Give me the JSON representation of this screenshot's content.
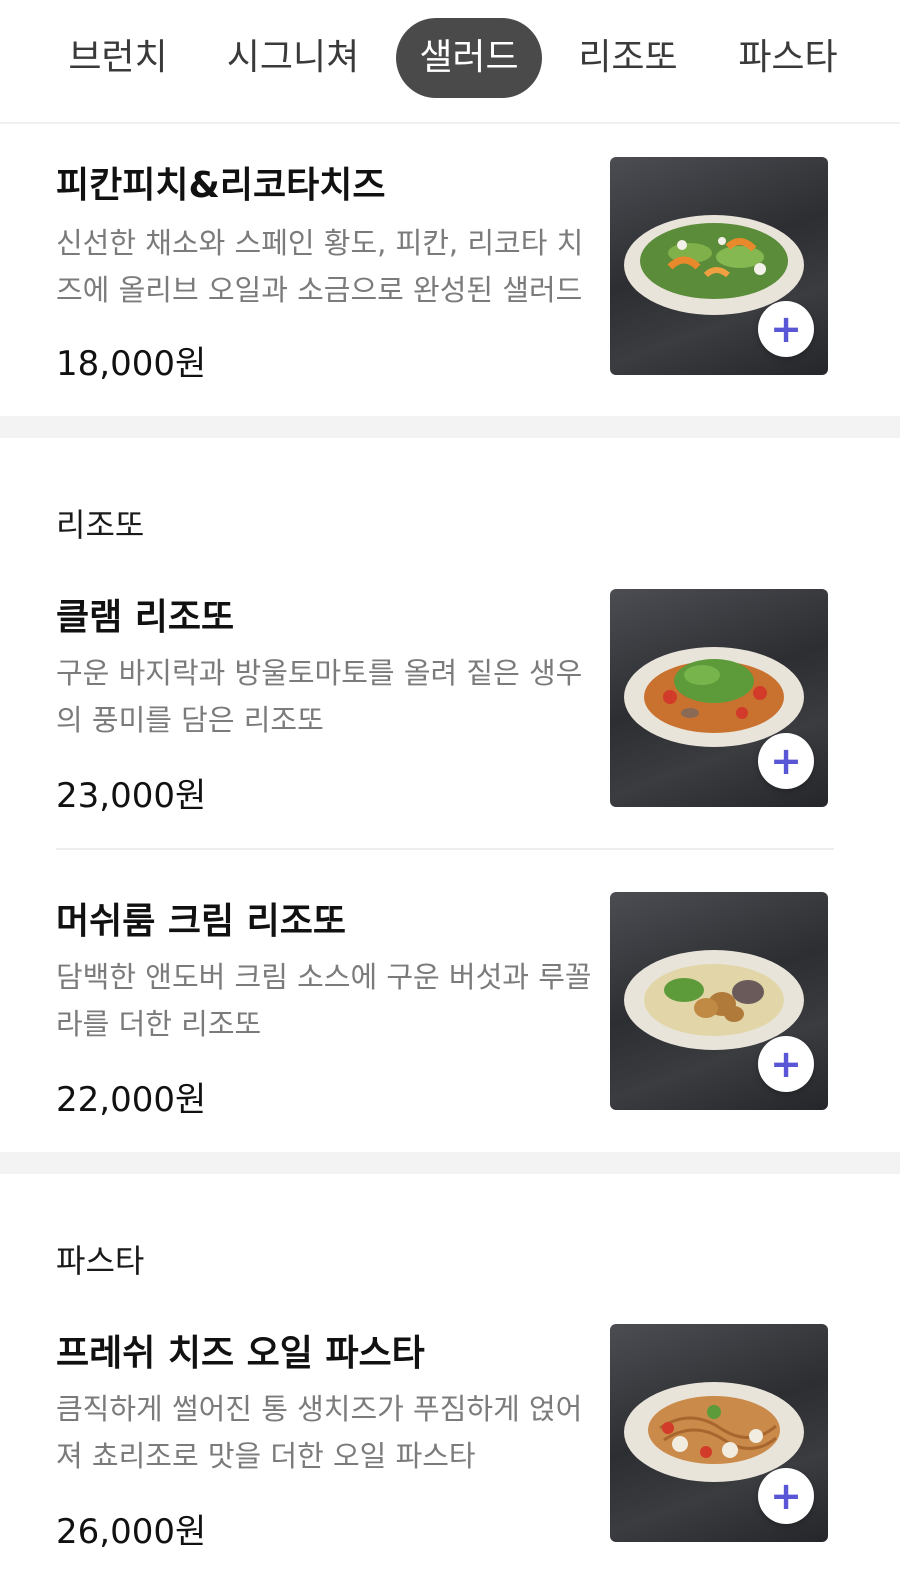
{
  "tabs": [
    {
      "label": "브런치",
      "active": false
    },
    {
      "label": "시그니쳐",
      "active": false
    },
    {
      "label": "샐러드",
      "active": true
    },
    {
      "label": "리조또",
      "active": false
    },
    {
      "label": "파스타",
      "active": false
    }
  ],
  "salad": {
    "items": [
      {
        "name": "피칸피치&리코타치즈",
        "description": "신선한 채소와 스페인 황도, 피칸, 리코타 치즈에 올리브 오일과 소금으로 완성된 샐러드",
        "price": "18,000원"
      }
    ]
  },
  "risotto": {
    "title": "리조또",
    "items": [
      {
        "name": "클램 리조또",
        "description": "구운 바지락과 방울토마토를 올려 짙은 생우의 풍미를 담은 리조또",
        "price": "23,000원"
      },
      {
        "name": "머쉬룸 크림 리조또",
        "description": "담백한 앤도버 크림 소스에 구운 버섯과 루꼴라를 더한 리조또",
        "price": "22,000원"
      }
    ]
  },
  "pasta": {
    "title": "파스타",
    "items": [
      {
        "name": "프레쉬 치즈 오일 파스타",
        "description": "큼직하게 썰어진 통 생치즈가 푸짐하게 얹어져 쵸리조로 맛을 더한 오일 파스타",
        "price": "26,000원"
      }
    ]
  },
  "icons": {
    "add": "plus-icon",
    "accent_color": "#5a57d6",
    "active_tab_color": "#4a4a4a"
  }
}
